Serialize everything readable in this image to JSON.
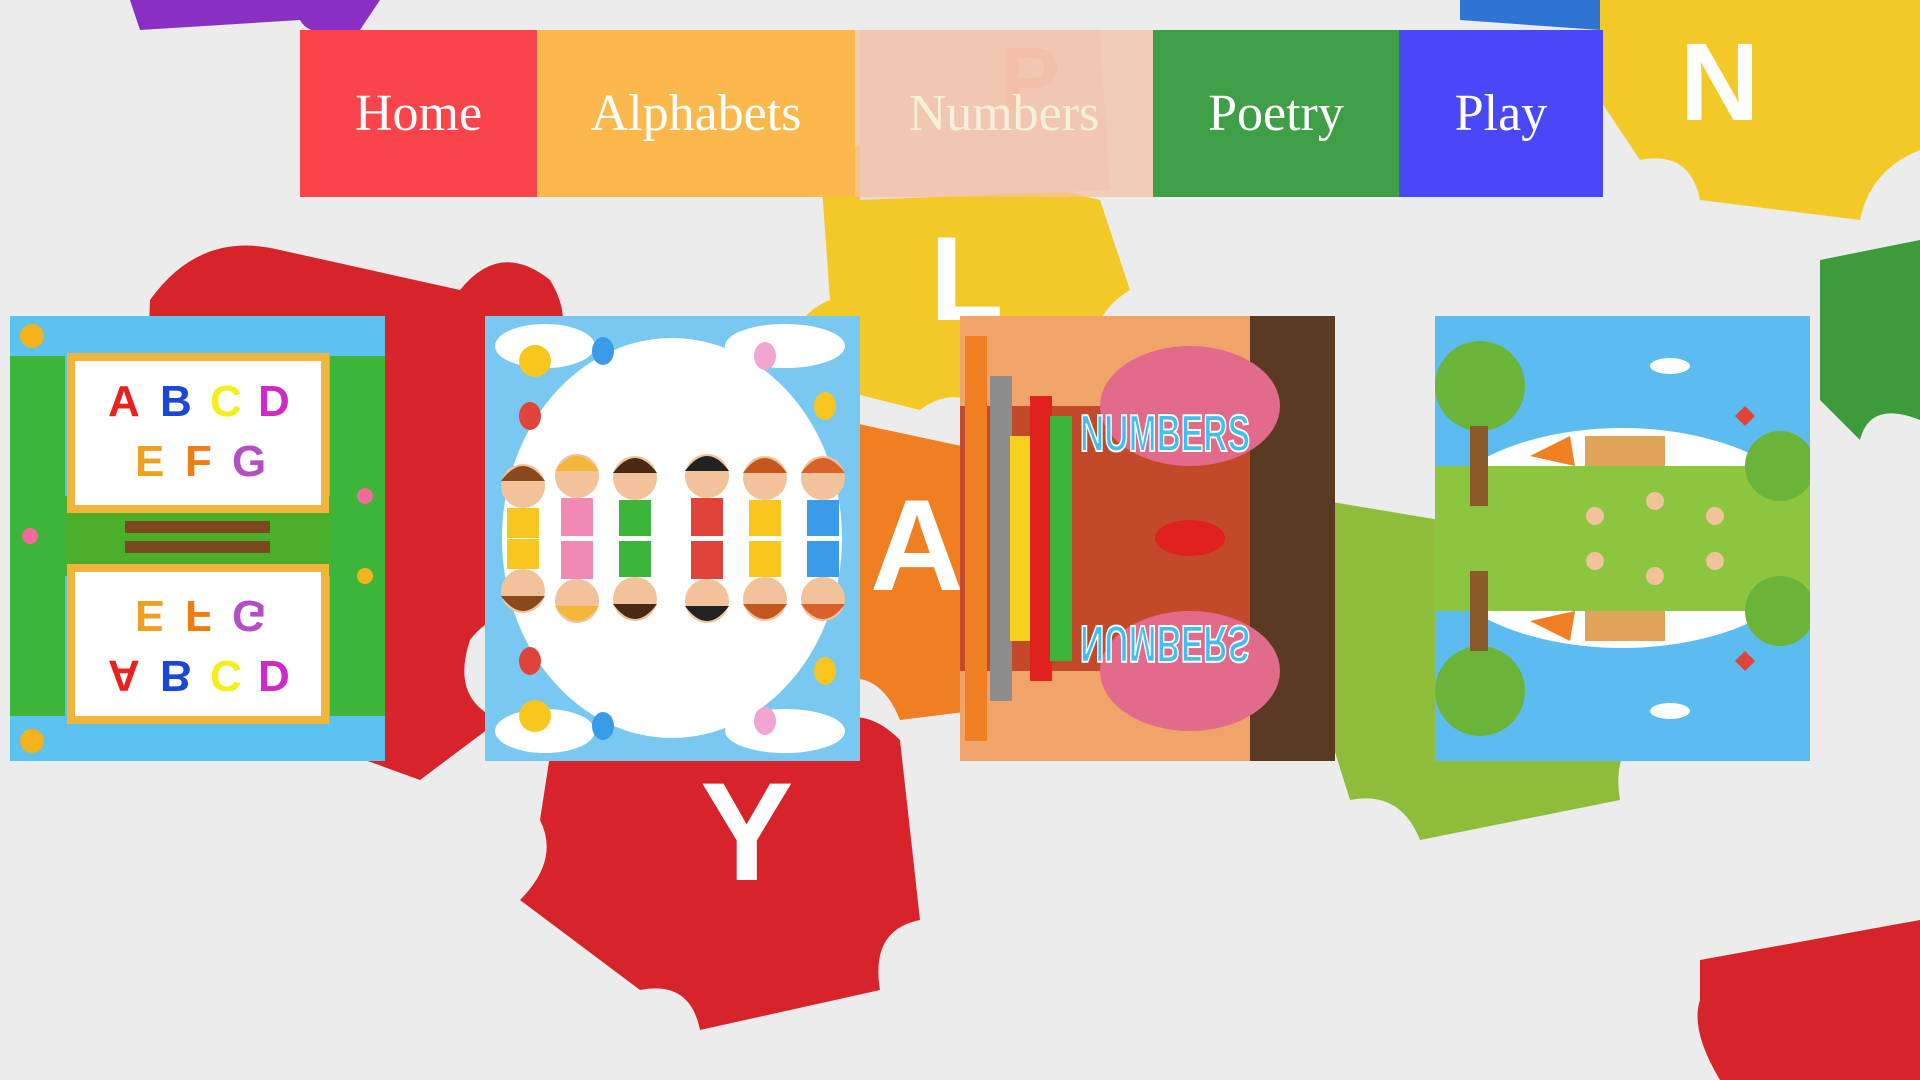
{
  "nav": {
    "items": [
      {
        "label": "Home",
        "color": "#f9444c"
      },
      {
        "label": "Alphabets",
        "color": "#fbb84c"
      },
      {
        "label": "Numbers",
        "color": "#f3c2a6"
      },
      {
        "label": "Poetry",
        "color": "#3f9f47"
      },
      {
        "label": "Play",
        "color": "#4a48f6"
      }
    ]
  },
  "cards": {
    "alphabets": {
      "row1": [
        "A",
        "B",
        "C",
        "D"
      ],
      "row2": [
        "E",
        "F",
        "G"
      ],
      "letter_colors": [
        "#e9211d",
        "#1b47d6",
        "#f4ee1c",
        "#d128c8",
        "#f0a021",
        "#f07d12",
        "#b24fc3"
      ]
    },
    "numbers": {
      "word": "NUMBERS"
    }
  },
  "background": {
    "piece_colors": [
      "#d6242a",
      "#f2c926",
      "#3d9b3c",
      "#2f74d3",
      "#f07f24",
      "#8a2fc4"
    ],
    "letters": [
      "P",
      "L",
      "A",
      "Y",
      "N"
    ]
  }
}
